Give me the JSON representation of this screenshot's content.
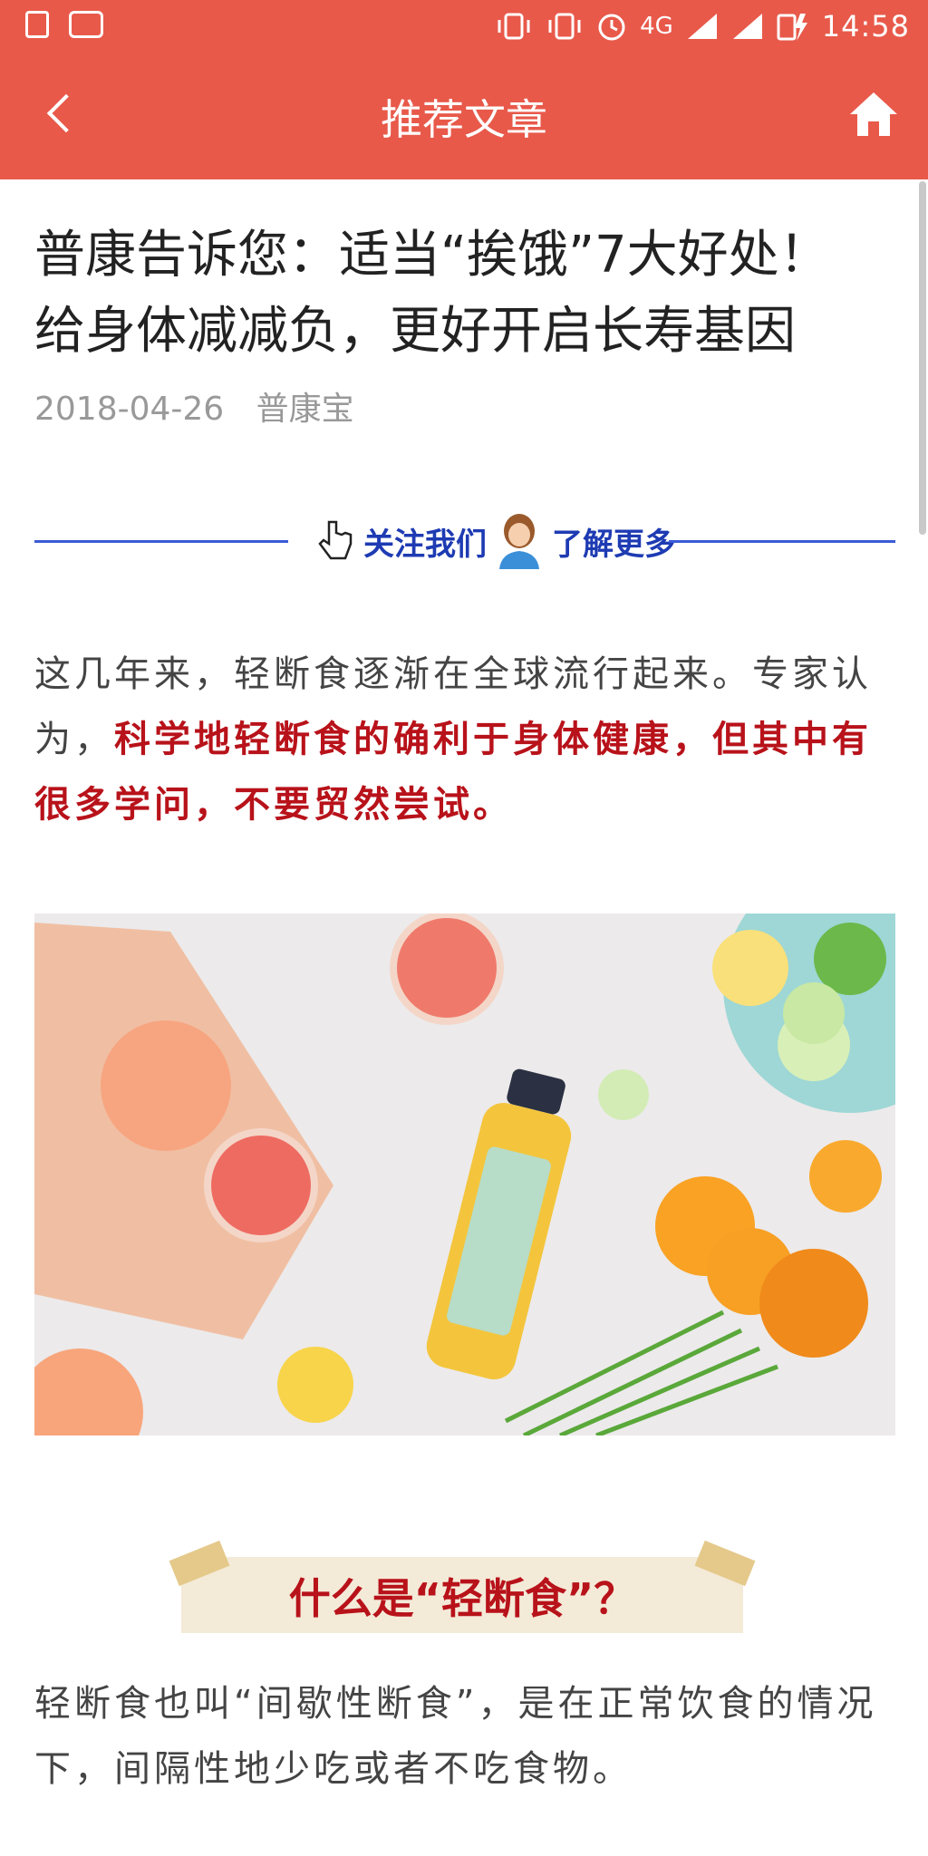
{
  "status_bar": {
    "network": "4G",
    "time": "14:58"
  },
  "header": {
    "title": "推荐文章"
  },
  "article": {
    "title_line1": "普康告诉您：适当“挨饿”7大好处！",
    "title_line2": "给身体减减负，更好开启长寿基因",
    "date": "2018-04-26",
    "source": "普康宝",
    "follow_left": "关注我们",
    "follow_right": "了解更多",
    "intro_plain": "这几年来，轻断食逐渐在全球流行起来。专家认为，",
    "intro_highlight": "科学地轻断食的确利于身体健康，但其中有很多学问，不要贸然尝试。",
    "section_title": "什么是“轻断食”？",
    "section_text": "轻断食也叫“间歇性断食”，是在正常饮食的情况下，间隔性地少吃或者不吃食物。"
  },
  "colors": {
    "header_bg": "#e8594a",
    "highlight_red": "#b8121a",
    "follow_blue": "#1e3bb3"
  },
  "icons": [
    "back-arrow-icon",
    "home-icon",
    "pointing-hand-icon",
    "person-icon",
    "vibrate-icon",
    "alarm-icon",
    "signal-icon",
    "battery-icon"
  ]
}
